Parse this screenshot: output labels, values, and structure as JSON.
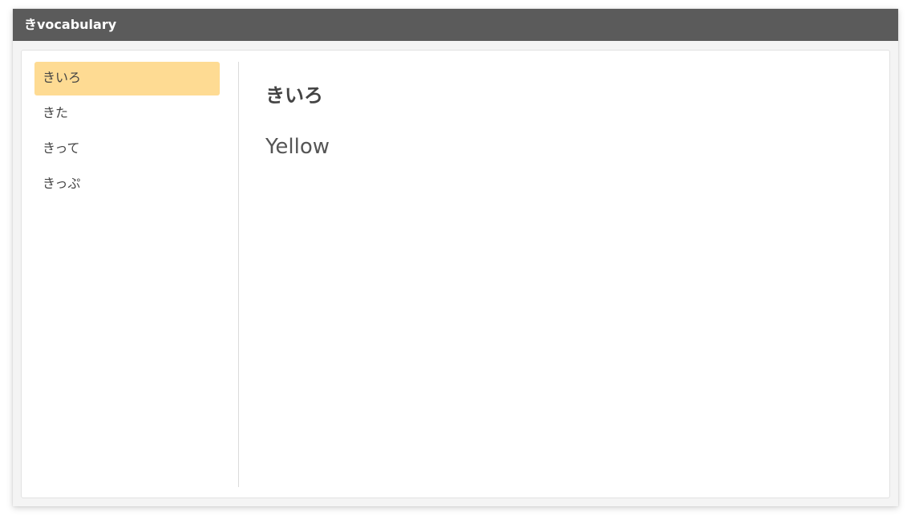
{
  "app": {
    "title": "きvocabulary"
  },
  "sidebar": {
    "items": [
      {
        "label": "きいろ",
        "selected": true
      },
      {
        "label": "きた",
        "selected": false
      },
      {
        "label": "きって",
        "selected": false
      },
      {
        "label": "きっぷ",
        "selected": false
      }
    ]
  },
  "detail": {
    "word": "きいろ",
    "meaning": "Yellow"
  },
  "colors": {
    "titlebar": "#5b5b5b",
    "selected_item": "#fedb93",
    "text": "#444444"
  }
}
